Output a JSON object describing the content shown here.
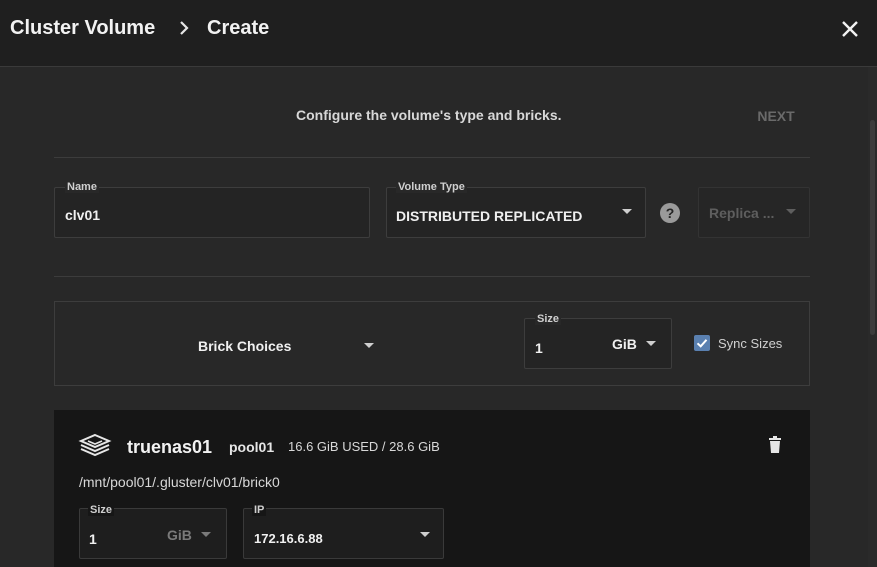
{
  "header": {
    "breadcrumb_root": "Cluster Volume",
    "breadcrumb_current": "Create",
    "icons": {
      "separator": "chevron-right-icon",
      "close": "close-icon"
    }
  },
  "step": {
    "instruction": "Configure the volume's type and bricks.",
    "next_label": "NEXT"
  },
  "form": {
    "name": {
      "label": "Name",
      "value": "clv01"
    },
    "volume_type": {
      "label": "Volume Type",
      "value": "DISTRIBUTED REPLICATED"
    },
    "replica": {
      "placeholder": "Replica ..."
    }
  },
  "brick_choices": {
    "label": "Brick Choices",
    "size": {
      "label": "Size",
      "value": "1",
      "unit": "GiB"
    },
    "sync_sizes": {
      "label": "Sync Sizes",
      "checked": true
    }
  },
  "brick": {
    "host": "truenas01",
    "pool": "pool01",
    "usage": "16.6 GiB USED / 28.6 GiB",
    "path": "/mnt/pool01/.gluster/clv01/brick0",
    "size": {
      "label": "Size",
      "value": "1",
      "unit": "GiB"
    },
    "ip": {
      "label": "IP",
      "value": "172.16.6.88"
    }
  },
  "colors": {
    "accent": "#5a80b0",
    "background": "#282828",
    "header": "#1f1f1f",
    "card": "#161616"
  }
}
